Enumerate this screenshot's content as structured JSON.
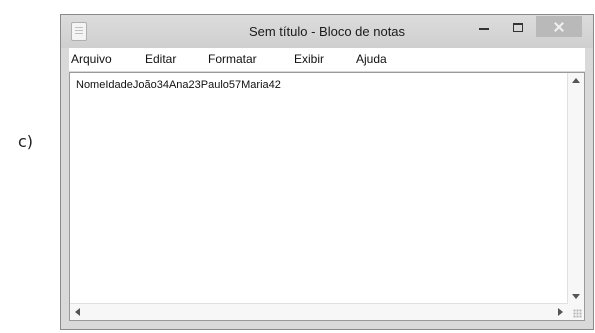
{
  "option_label": "c)",
  "window": {
    "title": "Sem título - Bloco de notas",
    "icons": {
      "app": "notepad-icon",
      "minimize": "minimize-icon",
      "maximize": "maximize-icon",
      "close": "close-icon"
    }
  },
  "menu": {
    "items": [
      {
        "label": "Arquivo"
      },
      {
        "label": "Editar"
      },
      {
        "label": "Formatar"
      },
      {
        "label": "Exibir"
      },
      {
        "label": "Ajuda"
      }
    ]
  },
  "editor": {
    "content": "NomeIdadeJoão34Ana23Paulo57Maria42"
  }
}
